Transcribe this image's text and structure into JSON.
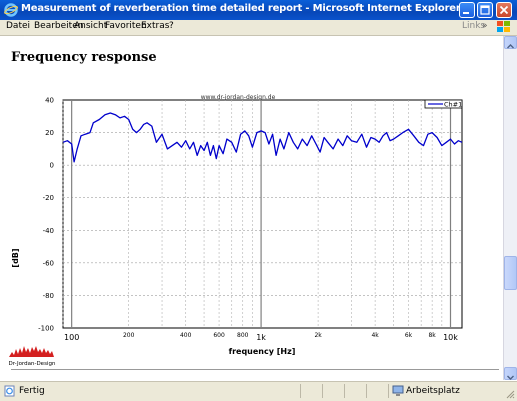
{
  "window": {
    "title": "Measurement of reverberation time detailed report - Microsoft Internet Explorer"
  },
  "menubar": {
    "items": [
      "Datei",
      "Bearbeiten",
      "Ansicht",
      "Favoriten",
      "Extras",
      "?"
    ],
    "links_label": "Links"
  },
  "page": {
    "heading": "Frequency response"
  },
  "chart_data": {
    "type": "line",
    "watermark": "www.dr-jordan-design.de",
    "xlabel": "frequency [Hz]",
    "ylabel": "[dB]",
    "xscale": "log",
    "xlim": [
      90,
      11500
    ],
    "ylim": [
      -100,
      40
    ],
    "y_ticks": [
      40,
      20,
      0,
      -20,
      -40,
      -60,
      -80,
      -100
    ],
    "x_ticks": [
      {
        "value": 100,
        "label": "100"
      },
      {
        "value": 200,
        "label": "200"
      },
      {
        "value": 400,
        "label": "400"
      },
      {
        "value": 600,
        "label": "600"
      },
      {
        "value": 800,
        "label": "800"
      },
      {
        "value": 1000,
        "label": "1k"
      },
      {
        "value": 2000,
        "label": "2k"
      },
      {
        "value": 4000,
        "label": "4k"
      },
      {
        "value": 6000,
        "label": "6k"
      },
      {
        "value": 8000,
        "label": "8k"
      },
      {
        "value": 10000,
        "label": "10k"
      }
    ],
    "grid": true,
    "legend": "top-right",
    "series": [
      {
        "name": "Ch#1",
        "color": "#0000cc",
        "x": [
          90,
          95,
          100,
          103,
          107,
          112,
          118,
          125,
          130,
          140,
          150,
          160,
          170,
          180,
          190,
          200,
          210,
          220,
          230,
          240,
          250,
          265,
          280,
          300,
          320,
          340,
          360,
          380,
          400,
          420,
          440,
          460,
          480,
          500,
          520,
          540,
          560,
          580,
          600,
          630,
          660,
          700,
          740,
          780,
          820,
          860,
          900,
          950,
          1000,
          1050,
          1100,
          1150,
          1200,
          1260,
          1320,
          1400,
          1480,
          1560,
          1650,
          1750,
          1850,
          1950,
          2050,
          2150,
          2250,
          2400,
          2550,
          2700,
          2850,
          3000,
          3200,
          3400,
          3600,
          3800,
          4000,
          4200,
          4400,
          4600,
          4800,
          5000,
          5300,
          5600,
          6000,
          6400,
          6800,
          7200,
          7600,
          8000,
          8500,
          9000,
          9500,
          10000,
          10500,
          11000,
          11500
        ],
        "y": [
          14,
          15,
          13,
          2,
          10,
          18,
          19,
          20,
          26,
          28,
          31,
          32,
          31,
          29,
          30,
          28,
          22,
          20,
          22,
          25,
          26,
          24,
          14,
          19,
          10,
          12,
          14,
          11,
          15,
          10,
          14,
          6,
          12,
          9,
          14,
          6,
          12,
          4,
          12,
          7,
          16,
          14,
          8,
          19,
          21,
          18,
          11,
          20,
          21,
          20,
          13,
          19,
          6,
          16,
          10,
          20,
          14,
          10,
          16,
          12,
          18,
          13,
          8,
          17,
          14,
          10,
          16,
          12,
          18,
          15,
          14,
          19,
          11,
          17,
          16,
          14,
          18,
          20,
          15,
          16,
          18,
          20,
          22,
          18,
          14,
          12,
          19,
          20,
          17,
          12,
          14,
          16,
          13,
          15,
          14
        ]
      }
    ]
  },
  "logo": {
    "caption": "Dr-Jordan-Design"
  },
  "statusbar": {
    "status": "Fertig",
    "zone": "Arbeitsplatz"
  },
  "colors": {
    "titlebar": "#0a52cc",
    "chrome": "#ece9d8",
    "plot_line": "#0000cc",
    "grid": "#a0a0a0",
    "logo_red": "#d42020"
  }
}
